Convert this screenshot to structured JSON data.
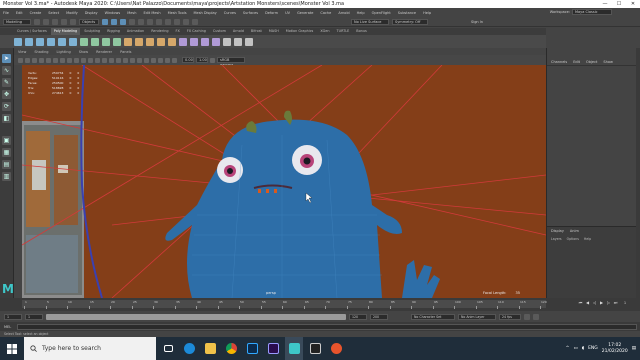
{
  "window": {
    "title": "Monster Vol 3.ma* - Autodesk Maya 2020: C:\\Users\\Nat Palazzo\\Documents\\maya\\projects\\Artstation Monsters\\scenes\\Monster Vol 3.ma",
    "minimize": "—",
    "maximize": "☐",
    "close": "✕"
  },
  "menubar": {
    "items": [
      "File",
      "Edit",
      "Create",
      "Select",
      "Modify",
      "Display",
      "Windows",
      "Mesh",
      "Edit Mesh",
      "Mesh Tools",
      "Mesh Display",
      "Curves",
      "Surfaces",
      "Deform",
      "UV",
      "Generate",
      "Cache",
      "Arnold",
      "Help",
      "OpenFlight",
      "Substance",
      "Help"
    ],
    "workspace_label": "Workspace:",
    "workspace_value": "Maya Classic"
  },
  "statusline": {
    "mode": "Modeling",
    "objects": "Objects",
    "live_surface": "No Live Surface",
    "symmetry": "Symmetry: Off",
    "sign_in": "Sign In"
  },
  "shelf": {
    "tabs": [
      "Curves / Surfaces",
      "Poly Modeling",
      "Sculpting",
      "Rigging",
      "Animation",
      "Rendering",
      "FX",
      "FX Caching",
      "Custom",
      "Arnold",
      "Bifrost",
      "MASH",
      "Motion Graphics",
      "XGen",
      "TURTLE",
      "Bonus"
    ],
    "active_tab": "Poly Modeling"
  },
  "panel": {
    "menu": [
      "View",
      "Shading",
      "Lighting",
      "Show",
      "Renderer",
      "Panels"
    ],
    "color_space": "sRGB gamma",
    "exposure": "0.00",
    "gamma": "1.00"
  },
  "hud": {
    "rows": [
      {
        "label": "Verts:",
        "a": "259734",
        "b": "0",
        "c": "0"
      },
      {
        "label": "Edges:",
        "a": "519116",
        "b": "0",
        "c": "0"
      },
      {
        "label": "Faces:",
        "a": "259500",
        "b": "0",
        "c": "0"
      },
      {
        "label": "Tris:",
        "a": "518828",
        "b": "0",
        "c": "0"
      },
      {
        "label": "UVs:",
        "a": "274613",
        "b": "0",
        "c": "0"
      }
    ],
    "camera": "persp",
    "focal_label": "Focal Length:",
    "focal_value": "35"
  },
  "channel_box": {
    "menu": [
      "Channels",
      "Edit",
      "Object",
      "Show"
    ],
    "display_tabs": [
      "Display",
      "Anim"
    ],
    "layer_menu": [
      "Layers",
      "Options",
      "Help"
    ]
  },
  "timeslider": {
    "ticks": [
      "1",
      "5",
      "10",
      "15",
      "20",
      "25",
      "30",
      "35",
      "40",
      "45",
      "50",
      "55",
      "60",
      "65",
      "70",
      "75",
      "80",
      "85",
      "90",
      "95",
      "100",
      "105",
      "110",
      "115",
      "120"
    ],
    "current_frame": "1"
  },
  "range": {
    "start": "1",
    "inner_start": "1",
    "inner_end": "120",
    "end": "120",
    "end2": "200",
    "character_set": "No Character Set",
    "anim_layer": "No Anim Layer",
    "fps": "24 fps"
  },
  "mel": {
    "label": "MEL"
  },
  "help_line": "Select Tool: select an object",
  "taskbar": {
    "search_placeholder": "Type here to search",
    "lang": "ENG",
    "time": "17:02",
    "date": "21/02/2020"
  },
  "colors": {
    "viewport_bg": "#843e18",
    "monster_blue": "#2d6ea8",
    "maya_teal": "#3ec7c9",
    "accent_blue": "#5d8fb7"
  }
}
